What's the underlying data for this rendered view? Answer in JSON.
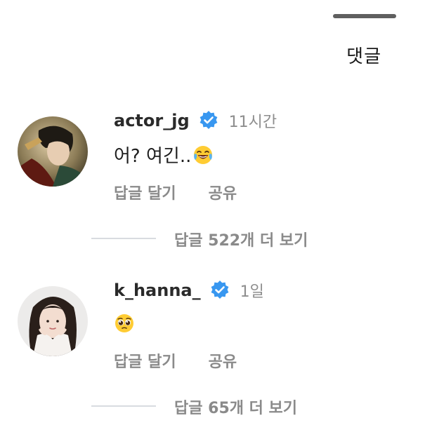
{
  "sheet": {
    "title": "댓글"
  },
  "comments": [
    {
      "username": "actor_jg",
      "verified": true,
      "time": "11시간",
      "text": "어? 여긴..",
      "emoji": "tears-of-joy-emoji",
      "reply_label": "답글 달기",
      "share_label": "공유",
      "more_replies_label": "답글 522개 더 보기"
    },
    {
      "username": "k_hanna_",
      "verified": true,
      "time": "1일",
      "text": "",
      "emoji": "pleading-face-emoji",
      "reply_label": "답글 달기",
      "share_label": "공유",
      "more_replies_label": "답글 65개 더 보기"
    }
  ],
  "colors": {
    "verified_badge": "#3897f0",
    "muted_text": "#8a8a8a",
    "handle": "#5f5f5f"
  }
}
